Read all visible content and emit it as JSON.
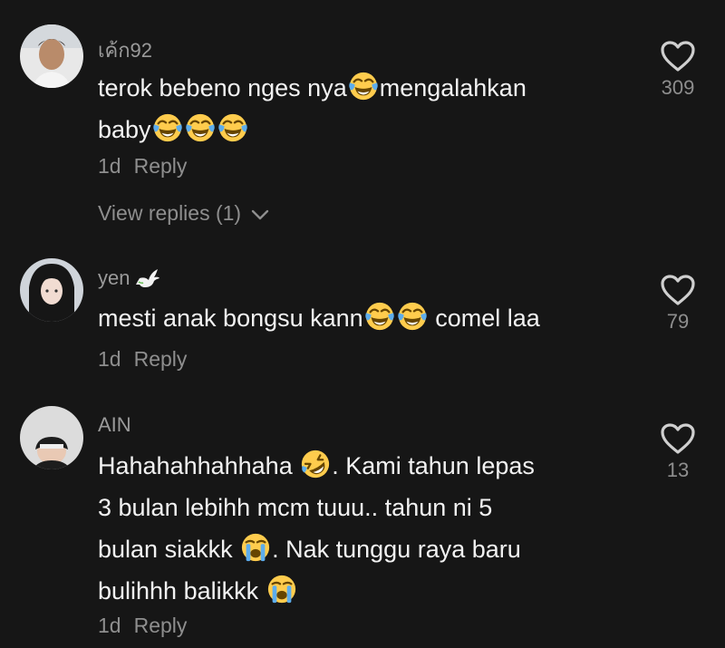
{
  "comments": [
    {
      "username": "เค้ก92",
      "text_parts": [
        "terok bebeno nges nya",
        "mengalahkan",
        "baby"
      ],
      "time": "1d",
      "reply_label": "Reply",
      "likes": "309",
      "view_replies_label": "View replies (1)"
    },
    {
      "username": "yen",
      "text_parts": [
        "mesti anak bongsu kann",
        "comel laa"
      ],
      "time": "1d",
      "reply_label": "Reply",
      "likes": "79"
    },
    {
      "username": "AIN",
      "text_parts": [
        "Hahahahhahhaha",
        ". Kami tahun lepas",
        "3 bulan lebihh mcm tuuu.. tahun ni 5",
        "bulan siakkk",
        ". Nak tunggu raya baru",
        "bulihhh balikkk"
      ],
      "time": "1d",
      "reply_label": "Reply",
      "likes": "13"
    }
  ],
  "colors": {
    "background": "#161616",
    "text": "#f2f2f2",
    "muted": "#8e8e8e"
  },
  "icons": {
    "like": "heart-outline-icon",
    "joy": "face-with-tears-of-joy-emoji",
    "rofl": "rolling-on-floor-laughing-emoji",
    "crying": "loudly-crying-face-emoji",
    "dove": "dove-emoji"
  }
}
